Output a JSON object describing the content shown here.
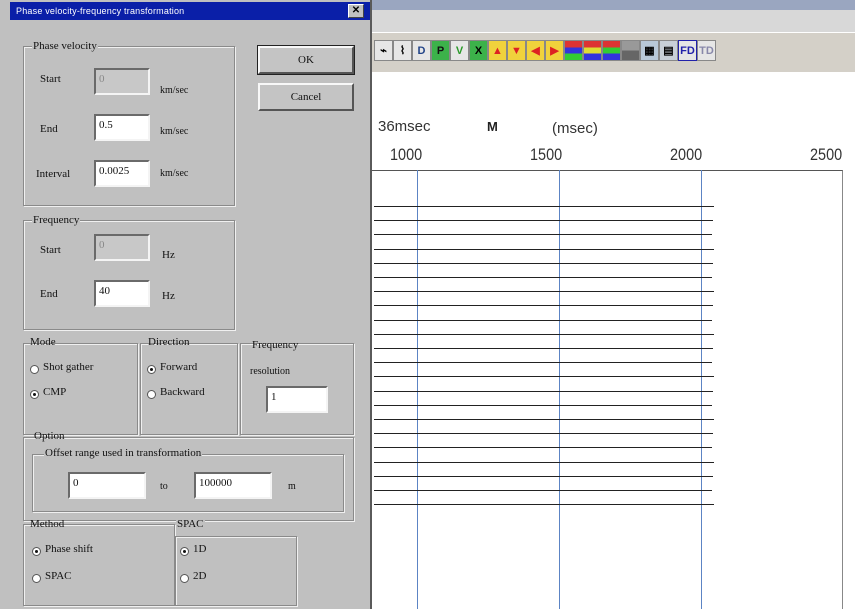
{
  "dialog": {
    "title": "Phase velocity-frequency transformation",
    "close_glyph": "✕",
    "ok_label": "OK",
    "cancel_label": "Cancel",
    "phase_velocity": {
      "group_label": "Phase velocity",
      "start_label": "Start",
      "start_value": "0",
      "start_unit": "km/sec",
      "end_label": "End",
      "end_value": "0.5",
      "end_unit": "km/sec",
      "interval_label": "Interval",
      "interval_value": "0.0025",
      "interval_unit": "km/sec"
    },
    "frequency": {
      "group_label": "Frequency",
      "start_label": "Start",
      "start_value": "0",
      "start_unit": "Hz",
      "end_label": "End",
      "end_value": "40",
      "end_unit": "Hz"
    },
    "mode": {
      "group_label": "Mode",
      "options": [
        {
          "label": "Shot gather",
          "checked": false
        },
        {
          "label": "CMP",
          "checked": true
        }
      ]
    },
    "direction": {
      "group_label": "Direction",
      "options": [
        {
          "label": "Forward",
          "checked": true
        },
        {
          "label": "Backward",
          "checked": false
        }
      ]
    },
    "frequency_resolution": {
      "label_line1": "Frequency",
      "label_line2": "resolution",
      "value": "1"
    },
    "option": {
      "group_label": "Option",
      "offset_label": "Offset range used in transformation",
      "from_value": "0",
      "to_label": "to",
      "to_value": "100000",
      "unit": "m"
    },
    "method": {
      "group_label": "Method",
      "options": [
        {
          "label": "Phase shift",
          "checked": true
        },
        {
          "label": "SPAC",
          "checked": false
        }
      ]
    },
    "spac": {
      "group_label": "SPAC",
      "options": [
        {
          "label": "1D",
          "checked": true
        },
        {
          "label": "2D",
          "checked": false
        }
      ]
    }
  },
  "background_app": {
    "plot": {
      "header_left": "36msec",
      "header_m": "M",
      "header_unit": "(msec)",
      "x_ticks": [
        "1000",
        "1500",
        "2000",
        "2500"
      ]
    },
    "toolbar_icons": [
      "wave-icon",
      "wave-alt-icon",
      "d-icon",
      "p-green-icon",
      "v-green-icon",
      "x-green-icon",
      "up-red-icon",
      "down-red-icon",
      "left-red-icon",
      "right-red-icon",
      "color-bar-1-icon",
      "color-bar-2-icon",
      "color-bar-3-icon",
      "gray-bar-icon",
      "grid-icon",
      "grid2-icon",
      "fd-icon",
      "td-icon"
    ]
  }
}
